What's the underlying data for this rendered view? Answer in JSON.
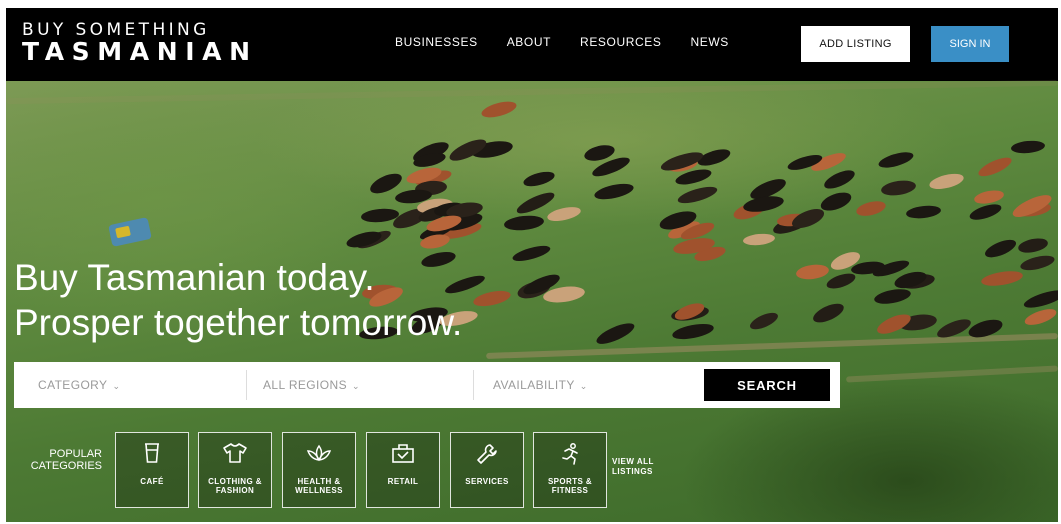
{
  "header": {
    "logo_line1": "BUY SOMETHING",
    "logo_line2": "TASMANIAN",
    "nav": [
      "BUSINESSES",
      "ABOUT",
      "RESOURCES",
      "NEWS"
    ],
    "add_listing_label": "ADD LISTING",
    "sign_in_label": "SIGN IN"
  },
  "hero": {
    "line1": "Buy Tasmanian today.",
    "line2": "Prosper together tomorrow."
  },
  "search": {
    "category": "CATEGORY",
    "regions": "ALL REGIONS",
    "availability": "AVAILABILITY",
    "button": "SEARCH"
  },
  "categories": {
    "label_line1": "POPULAR",
    "label_line2": "CATEGORIES",
    "items": [
      {
        "line1": "CAFÉ",
        "line2": "",
        "icon": "coffee-cup-icon"
      },
      {
        "line1": "CLOTHING &",
        "line2": "FASHION",
        "icon": "tshirt-icon"
      },
      {
        "line1": "HEALTH &",
        "line2": "WELLNESS",
        "icon": "lotus-icon"
      },
      {
        "line1": "RETAIL",
        "line2": "",
        "icon": "shopping-bag-icon"
      },
      {
        "line1": "SERVICES",
        "line2": "",
        "icon": "wrench-icon"
      },
      {
        "line1": "SPORTS &",
        "line2": "FITNESS",
        "icon": "runner-icon"
      }
    ],
    "view_all_line1": "VIEW ALL",
    "view_all_line2": "LISTINGS"
  },
  "colors": {
    "header_bg": "#000000",
    "sign_in_bg": "#3a8fc6",
    "search_button_bg": "#000000"
  }
}
